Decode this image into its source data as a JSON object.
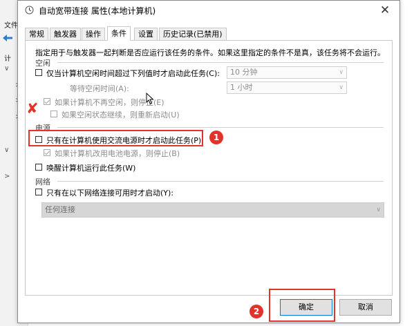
{
  "background_app": {
    "menu_file": "文件",
    "item_computer": "计"
  },
  "dialog": {
    "title": "自动宽带连接 属性(本地计算机)",
    "close_glyph": "✕"
  },
  "tabs": [
    {
      "label": "常规"
    },
    {
      "label": "触发器"
    },
    {
      "label": "操作"
    },
    {
      "label": "条件"
    },
    {
      "label": "设置"
    },
    {
      "label": "历史记录(已禁用)"
    }
  ],
  "conditions": {
    "description": "指定用于与触发器一起判断是否应运行该任务的条件。如果这里指定的条件不是真，该任务将不会运行。",
    "idle": {
      "group_label": "空闲",
      "start_only_idle": "仅当计算机空闲时间超过下列值时才启动此任务(C):",
      "idle_minutes_value": "10 分钟",
      "wait_idle_label": "等待空闲时间(A):",
      "wait_value": "1 小时",
      "stop_if_not_idle": "如果计算机不再空闲，则停止(E)",
      "restart_if_idle": "如果空闲状态继续，则重新启动(U)"
    },
    "power": {
      "group_label": "电源",
      "start_only_ac": "只有在计算机使用交流电源时才启动此任务(P)",
      "stop_on_battery": "如果计算机改用电池电源，则停止(B)",
      "wake_to_run": "唤醒计算机运行此任务(W)"
    },
    "network": {
      "group_label": "网络",
      "start_only_network": "只有在以下网络连接可用时才启动(Y):",
      "network_value": "任何连接"
    }
  },
  "buttons": {
    "ok": "确定",
    "cancel": "取消"
  },
  "annotations": {
    "step1": "1",
    "step2": "2",
    "mark": "✘"
  },
  "colors": {
    "highlight_red": "#e2322a",
    "primary_border": "#0078d7"
  }
}
